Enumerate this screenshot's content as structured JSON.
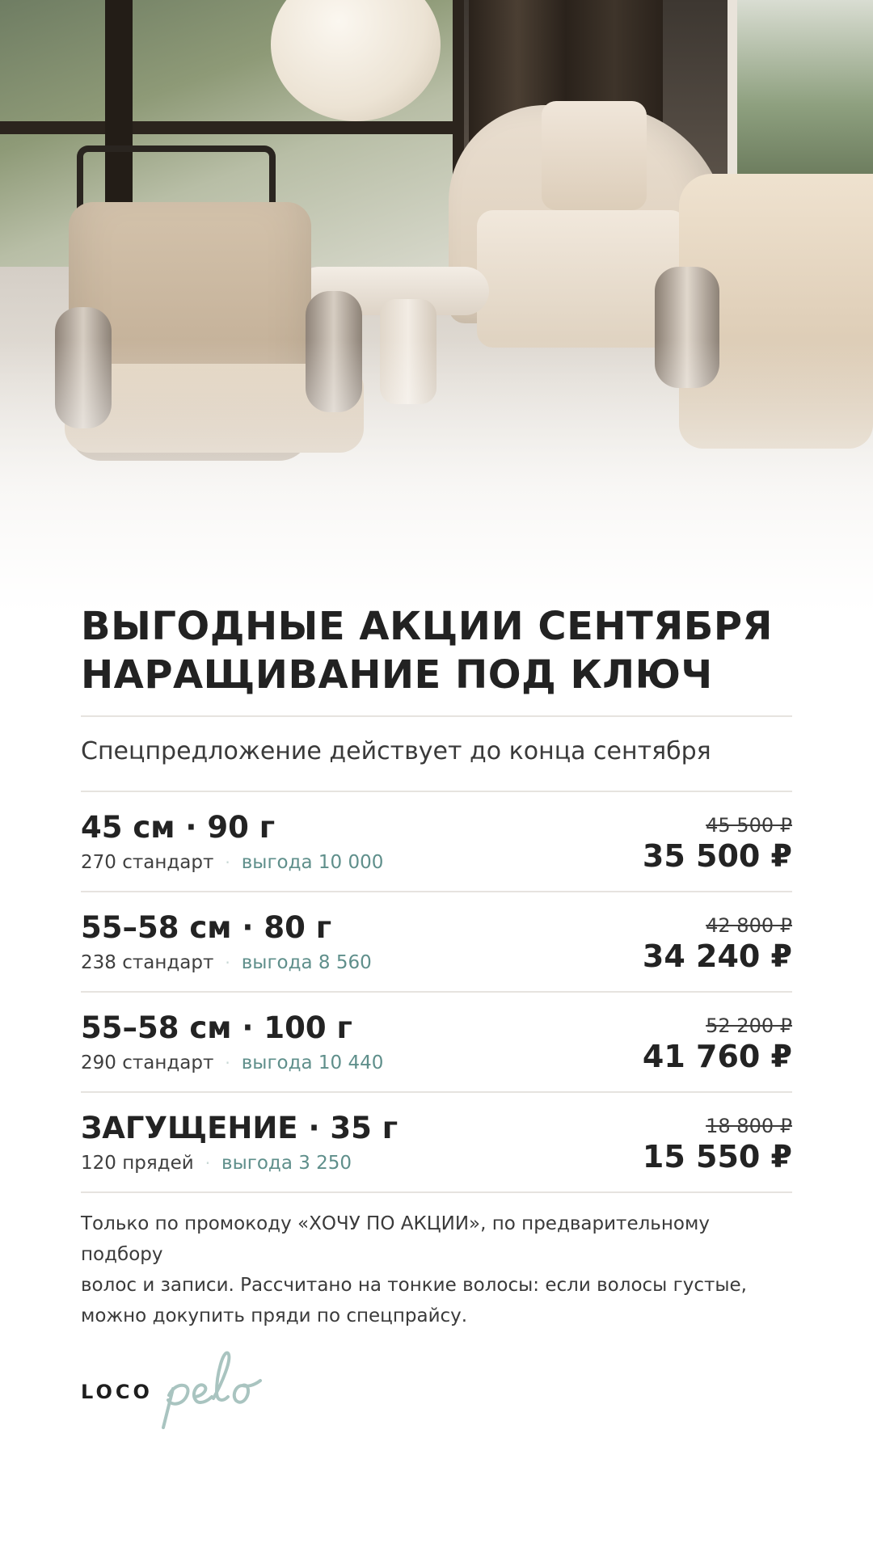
{
  "hero": {
    "description_icon": "salon-interior-photo"
  },
  "title": {
    "line1": "ВЫГОДНЫЕ АКЦИИ СЕНТЯБРЯ",
    "line2": "НАРАЩИВАНИЕ ПОД КЛЮЧ"
  },
  "subtitle": "Спецпредложение действует до конца сентября",
  "offers": [
    {
      "name": "45 см · 90 г",
      "count": "270 стандарт",
      "save": "выгода 10 000",
      "old_price": "45 500 ₽",
      "new_price": "35 500 ₽"
    },
    {
      "name": "55–58 см · 80 г",
      "count": "238 стандарт",
      "save": "выгода 8 560",
      "old_price": "42 800 ₽",
      "new_price": "34 240 ₽"
    },
    {
      "name": "55–58 см · 100 г",
      "count": "290 стандарт",
      "save": "выгода 10 440",
      "old_price": "52 200 ₽",
      "new_price": "41 760 ₽"
    },
    {
      "name": "ЗАГУЩЕНИЕ · 35 г",
      "count": "120 прядей",
      "save": "выгода 3 250",
      "old_price": "18 800 ₽",
      "new_price": "15 550 ₽"
    }
  ],
  "separator_dot": "·",
  "note": {
    "line1": "Только по промокоду «ХОЧУ ПО АКЦИИ», по предварительному подбору",
    "line2": "волос и записи. Рассчитано на тонкие волосы: если волосы густые,",
    "line3": "можно докупить пряди по спецпрайсу."
  },
  "logo": {
    "part1": "LOCO",
    "part2": "pelo"
  },
  "colors": {
    "accent": "#5f8f8b",
    "accent_light": "#a9c4c0",
    "text": "#232323",
    "divider": "#e6e3df"
  }
}
